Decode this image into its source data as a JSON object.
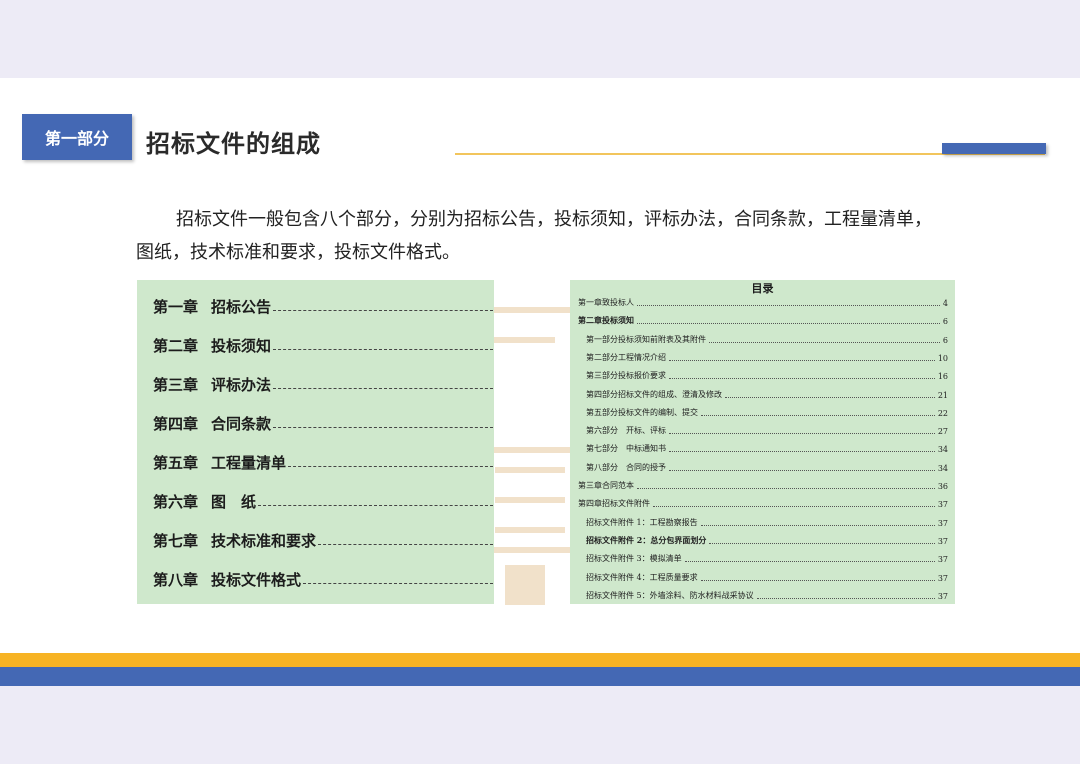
{
  "section": {
    "badge": "第一部分",
    "title": "招标文件的组成"
  },
  "colors": {
    "accent_blue": "#4468b4",
    "accent_gold": "#f7b324",
    "panel_green": "#cfe8cc"
  },
  "intro": {
    "text": "招标文件一般包含八个部分，分别为招标公告，投标须知，评标办法，合同条款，工程量清单，图纸，技术标准和要求，投标文件格式。"
  },
  "toc_left": {
    "items": [
      {
        "chapter": "第一章",
        "name": "招标公告"
      },
      {
        "chapter": "第二章",
        "name": "投标须知"
      },
      {
        "chapter": "第三章",
        "name": "评标办法"
      },
      {
        "chapter": "第四章",
        "name": "合同条款"
      },
      {
        "chapter": "第五章",
        "name": "工程量清单"
      },
      {
        "chapter": "第六章",
        "name": "图　纸"
      },
      {
        "chapter": "第七章",
        "name": "技术标准和要求"
      },
      {
        "chapter": "第八章",
        "name": "投标文件格式"
      }
    ]
  },
  "toc_right": {
    "title": "目录",
    "items": [
      {
        "text": "第一章致投标人",
        "page": "4",
        "bold": false,
        "indent": false
      },
      {
        "text": "第二章投标须知",
        "page": "6",
        "bold": true,
        "indent": false
      },
      {
        "text": "第一部分投标须知前附表及其附件",
        "page": "6",
        "bold": false,
        "indent": true
      },
      {
        "text": "第二部分工程情况介绍",
        "page": "10",
        "bold": false,
        "indent": true
      },
      {
        "text": "第三部分投标报价要求",
        "page": "16",
        "bold": false,
        "indent": true
      },
      {
        "text": "第四部分招标文件的组成、澄清及修改",
        "page": "21",
        "bold": false,
        "indent": true
      },
      {
        "text": "第五部分投标文件的编制、提交",
        "page": "22",
        "bold": false,
        "indent": true
      },
      {
        "text": "第六部分　开标、评标",
        "page": "27",
        "bold": false,
        "indent": true
      },
      {
        "text": "第七部分　中标通知书",
        "page": "34",
        "bold": false,
        "indent": true
      },
      {
        "text": "第八部分　合同的授予",
        "page": "34",
        "bold": false,
        "indent": true
      },
      {
        "text": "第三章合同范本",
        "page": "36",
        "bold": false,
        "indent": false
      },
      {
        "text": "第四章招标文件附件",
        "page": "37",
        "bold": false,
        "indent": false
      },
      {
        "text": "招标文件附件 1：工程勘察报告",
        "page": "37",
        "bold": false,
        "indent": true
      },
      {
        "text": "招标文件附件 2：总分包界面划分",
        "page": "37",
        "bold": true,
        "indent": true
      },
      {
        "text": "招标文件附件 3：模拟清单",
        "page": "37",
        "bold": false,
        "indent": true
      },
      {
        "text": "招标文件附件 4：工程质量要求",
        "page": "37",
        "bold": false,
        "indent": true
      },
      {
        "text": "招标文件附件 5：外墙涂料、防水材料战采协议",
        "page": "37",
        "bold": false,
        "indent": true
      }
    ]
  }
}
